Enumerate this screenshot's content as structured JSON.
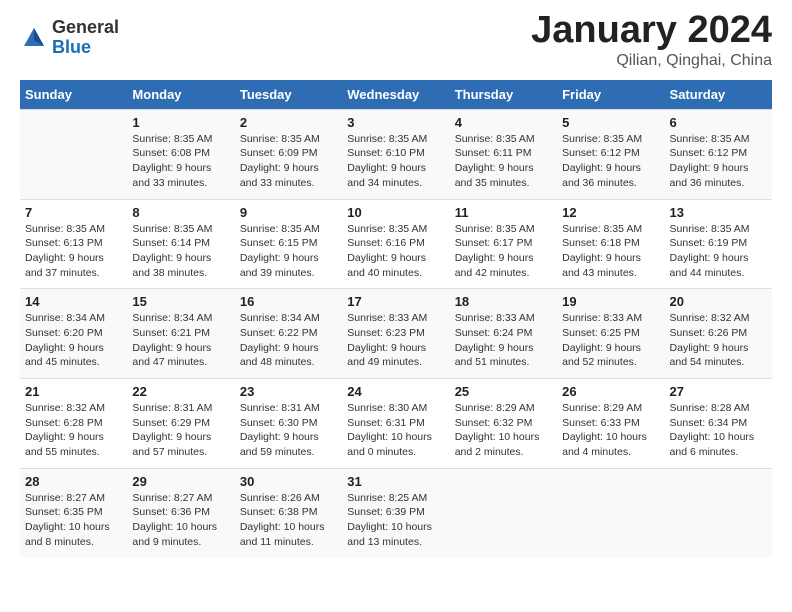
{
  "header": {
    "logo_general": "General",
    "logo_blue": "Blue",
    "title": "January 2024",
    "location": "Qilian, Qinghai, China"
  },
  "columns": [
    "Sunday",
    "Monday",
    "Tuesday",
    "Wednesday",
    "Thursday",
    "Friday",
    "Saturday"
  ],
  "weeks": [
    [
      {
        "day": "",
        "info": ""
      },
      {
        "day": "1",
        "info": "Sunrise: 8:35 AM\nSunset: 6:08 PM\nDaylight: 9 hours\nand 33 minutes."
      },
      {
        "day": "2",
        "info": "Sunrise: 8:35 AM\nSunset: 6:09 PM\nDaylight: 9 hours\nand 33 minutes."
      },
      {
        "day": "3",
        "info": "Sunrise: 8:35 AM\nSunset: 6:10 PM\nDaylight: 9 hours\nand 34 minutes."
      },
      {
        "day": "4",
        "info": "Sunrise: 8:35 AM\nSunset: 6:11 PM\nDaylight: 9 hours\nand 35 minutes."
      },
      {
        "day": "5",
        "info": "Sunrise: 8:35 AM\nSunset: 6:12 PM\nDaylight: 9 hours\nand 36 minutes."
      },
      {
        "day": "6",
        "info": "Sunrise: 8:35 AM\nSunset: 6:12 PM\nDaylight: 9 hours\nand 36 minutes."
      }
    ],
    [
      {
        "day": "7",
        "info": "Sunrise: 8:35 AM\nSunset: 6:13 PM\nDaylight: 9 hours\nand 37 minutes."
      },
      {
        "day": "8",
        "info": "Sunrise: 8:35 AM\nSunset: 6:14 PM\nDaylight: 9 hours\nand 38 minutes."
      },
      {
        "day": "9",
        "info": "Sunrise: 8:35 AM\nSunset: 6:15 PM\nDaylight: 9 hours\nand 39 minutes."
      },
      {
        "day": "10",
        "info": "Sunrise: 8:35 AM\nSunset: 6:16 PM\nDaylight: 9 hours\nand 40 minutes."
      },
      {
        "day": "11",
        "info": "Sunrise: 8:35 AM\nSunset: 6:17 PM\nDaylight: 9 hours\nand 42 minutes."
      },
      {
        "day": "12",
        "info": "Sunrise: 8:35 AM\nSunset: 6:18 PM\nDaylight: 9 hours\nand 43 minutes."
      },
      {
        "day": "13",
        "info": "Sunrise: 8:35 AM\nSunset: 6:19 PM\nDaylight: 9 hours\nand 44 minutes."
      }
    ],
    [
      {
        "day": "14",
        "info": "Sunrise: 8:34 AM\nSunset: 6:20 PM\nDaylight: 9 hours\nand 45 minutes."
      },
      {
        "day": "15",
        "info": "Sunrise: 8:34 AM\nSunset: 6:21 PM\nDaylight: 9 hours\nand 47 minutes."
      },
      {
        "day": "16",
        "info": "Sunrise: 8:34 AM\nSunset: 6:22 PM\nDaylight: 9 hours\nand 48 minutes."
      },
      {
        "day": "17",
        "info": "Sunrise: 8:33 AM\nSunset: 6:23 PM\nDaylight: 9 hours\nand 49 minutes."
      },
      {
        "day": "18",
        "info": "Sunrise: 8:33 AM\nSunset: 6:24 PM\nDaylight: 9 hours\nand 51 minutes."
      },
      {
        "day": "19",
        "info": "Sunrise: 8:33 AM\nSunset: 6:25 PM\nDaylight: 9 hours\nand 52 minutes."
      },
      {
        "day": "20",
        "info": "Sunrise: 8:32 AM\nSunset: 6:26 PM\nDaylight: 9 hours\nand 54 minutes."
      }
    ],
    [
      {
        "day": "21",
        "info": "Sunrise: 8:32 AM\nSunset: 6:28 PM\nDaylight: 9 hours\nand 55 minutes."
      },
      {
        "day": "22",
        "info": "Sunrise: 8:31 AM\nSunset: 6:29 PM\nDaylight: 9 hours\nand 57 minutes."
      },
      {
        "day": "23",
        "info": "Sunrise: 8:31 AM\nSunset: 6:30 PM\nDaylight: 9 hours\nand 59 minutes."
      },
      {
        "day": "24",
        "info": "Sunrise: 8:30 AM\nSunset: 6:31 PM\nDaylight: 10 hours\nand 0 minutes."
      },
      {
        "day": "25",
        "info": "Sunrise: 8:29 AM\nSunset: 6:32 PM\nDaylight: 10 hours\nand 2 minutes."
      },
      {
        "day": "26",
        "info": "Sunrise: 8:29 AM\nSunset: 6:33 PM\nDaylight: 10 hours\nand 4 minutes."
      },
      {
        "day": "27",
        "info": "Sunrise: 8:28 AM\nSunset: 6:34 PM\nDaylight: 10 hours\nand 6 minutes."
      }
    ],
    [
      {
        "day": "28",
        "info": "Sunrise: 8:27 AM\nSunset: 6:35 PM\nDaylight: 10 hours\nand 8 minutes."
      },
      {
        "day": "29",
        "info": "Sunrise: 8:27 AM\nSunset: 6:36 PM\nDaylight: 10 hours\nand 9 minutes."
      },
      {
        "day": "30",
        "info": "Sunrise: 8:26 AM\nSunset: 6:38 PM\nDaylight: 10 hours\nand 11 minutes."
      },
      {
        "day": "31",
        "info": "Sunrise: 8:25 AM\nSunset: 6:39 PM\nDaylight: 10 hours\nand 13 minutes."
      },
      {
        "day": "",
        "info": ""
      },
      {
        "day": "",
        "info": ""
      },
      {
        "day": "",
        "info": ""
      }
    ]
  ]
}
